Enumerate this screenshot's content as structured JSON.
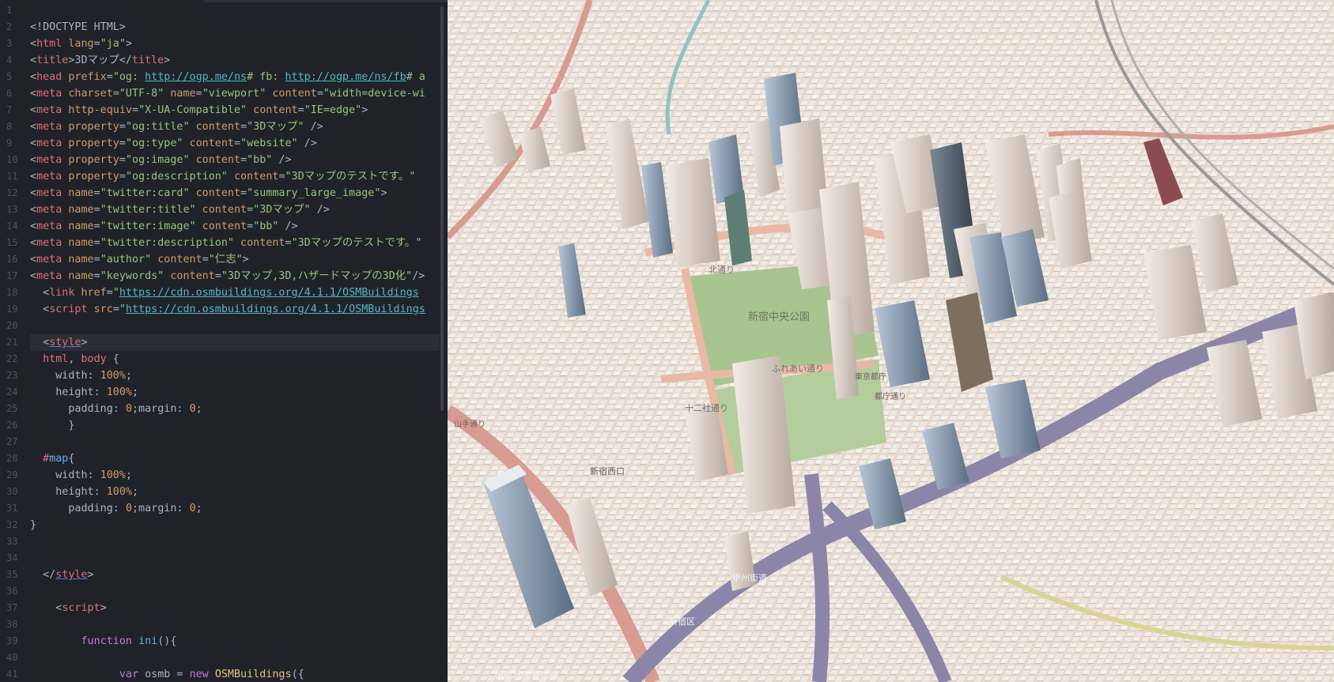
{
  "line_numbers": [
    "1",
    "2",
    "3",
    "4",
    "5",
    "6",
    "7",
    "8",
    "9",
    "10",
    "11",
    "12",
    "13",
    "14",
    "15",
    "16",
    "17",
    "18",
    "19",
    "20",
    "21",
    "22",
    "23",
    "24",
    "25",
    "26",
    "27",
    "28",
    "29",
    "30",
    "31",
    "32",
    "33",
    "34",
    "35",
    "36",
    "37",
    "38",
    "39",
    "40",
    "41"
  ],
  "code": {
    "l2": "<!DOCTYPE HTML>",
    "l3": {
      "o": "<",
      "tag": "html",
      "attr": " lang",
      "eq": "=",
      "val": "\"ja\"",
      "c": ">"
    },
    "l4": {
      "o": "<",
      "tag": "title",
      "mid": ">3Dマップ</",
      "tag2": "title",
      "c": ">"
    },
    "l5": {
      "o": "<",
      "tag": "head",
      "attr": " prefix",
      "eq": "=",
      "q1": "\"og: ",
      "url1": "http://ogp.me/ns",
      "mid": "# fb: ",
      "url2": "http://ogp.me/ns/fb",
      "tail": "# a"
    },
    "l6": {
      "o": "<",
      "tag": "meta",
      "a1": " charset",
      "eq1": "=",
      "v1": "\"UTF-8\"",
      "a2": " name",
      "eq2": "=",
      "v2": "\"viewport\"",
      "a3": " content",
      "eq3": "=",
      "v3": "\"width=device-wi"
    },
    "l7": {
      "o": "<",
      "tag": "meta",
      "a1": " http-equiv",
      "eq1": "=",
      "v1": "\"X-UA-Compatible\"",
      "a2": " content",
      "eq2": "=",
      "v2": "\"IE=edge\"",
      "c": ">"
    },
    "l8": {
      "o": "<",
      "tag": "meta",
      "a1": " property",
      "eq1": "=",
      "v1": "\"og:title\"",
      "a2": " content",
      "eq2": "=",
      "v2": "\"3Dマップ\"",
      "c": " />"
    },
    "l9": {
      "o": "<",
      "tag": "meta",
      "a1": " property",
      "eq1": "=",
      "v1": "\"og:type\"",
      "a2": " content",
      "eq2": "=",
      "v2": "\"website\"",
      "c": " />"
    },
    "l10": {
      "o": "<",
      "tag": "meta",
      "a1": " property",
      "eq1": "=",
      "v1": "\"og:image\"",
      "a2": " content",
      "eq2": "=",
      "v2": "\"bb\"",
      "c": " />"
    },
    "l11": {
      "o": "<",
      "tag": "meta",
      "a1": " property",
      "eq1": "=",
      "v1": "\"og:description\"",
      "a2": " content",
      "eq2": "=",
      "v2": "\"3Dマップのテストです。\""
    },
    "l12": {
      "o": "<",
      "tag": "meta",
      "a1": " name",
      "eq1": "=",
      "v1": "\"twitter:card\"",
      "a2": " content",
      "eq2": "=",
      "v2": "\"summary_large_image\"",
      "c": ">"
    },
    "l13": {
      "o": "<",
      "tag": "meta",
      "a1": " name",
      "eq1": "=",
      "v1": "\"twitter:title\"",
      "a2": " content",
      "eq2": "=",
      "v2": "\"3Dマップ\"",
      "c": " />"
    },
    "l14": {
      "o": "<",
      "tag": "meta",
      "a1": " name",
      "eq1": "=",
      "v1": "\"twitter:image\"",
      "a2": " content",
      "eq2": "=",
      "v2": "\"bb\"",
      "c": " />"
    },
    "l15": {
      "o": "<",
      "tag": "meta",
      "a1": " name",
      "eq1": "=",
      "v1": "\"twitter:description\"",
      "a2": " content",
      "eq2": "=",
      "v2": "\"3Dマップのテストです。\""
    },
    "l16": {
      "o": "<",
      "tag": "meta",
      "a1": " name",
      "eq1": "=",
      "v1": "\"author\"",
      "a2": " content",
      "eq2": "=",
      "v2": "\"仁志\"",
      "c": ">"
    },
    "l17": {
      "o": "<",
      "tag": "meta",
      "a1": " name",
      "eq1": "=",
      "v1": "\"keywords\"",
      "a2": " content",
      "eq2": "=",
      "v2": "\"3Dマップ,3D,ハザードマップの3D化\"",
      "c": "/>"
    },
    "l18": {
      "ind": "  ",
      "o": "<",
      "tag": "link",
      "a1": " href",
      "eq1": "=",
      "q": "\"",
      "url": "https://cdn.osmbuildings.org/4.1.1/OSMBuildings"
    },
    "l19": {
      "ind": "  ",
      "o": "<",
      "tag": "script",
      "a1": " src",
      "eq1": "=",
      "q": "\"",
      "url": "https://cdn.osmbuildings.org/4.1.1/OSMBuildings"
    },
    "l21": {
      "ind": "  ",
      "o": "<",
      "tag": "style",
      "c": ">"
    },
    "l22": {
      "ind": "  ",
      "s1": "html",
      "sep": ", ",
      "s2": "body",
      "rest": " {"
    },
    "l23": {
      "ind": "    ",
      "prop": "width: ",
      "num": "100%",
      "end": ";"
    },
    "l24": {
      "ind": "    ",
      "prop": "height: ",
      "num": "100%",
      "end": ";"
    },
    "l25": {
      "ind": "      ",
      "prop": "padding: ",
      "num": "0",
      "mid": ";margin: ",
      "num2": "0",
      "end": ";"
    },
    "l26": "      }",
    "l28": {
      "ind": "  ",
      "hash": "#",
      "sel": "map",
      "rest": "{"
    },
    "l29": {
      "ind": "    ",
      "prop": "width: ",
      "num": "100%",
      "end": ";"
    },
    "l30": {
      "ind": "    ",
      "prop": "height: ",
      "num": "100%",
      "end": ";"
    },
    "l31": {
      "ind": "      ",
      "prop": "padding: ",
      "num": "0",
      "mid": ";margin: ",
      "num2": "0",
      "end": ";"
    },
    "l32": "}",
    "l35": {
      "ind": "  ",
      "o": "</",
      "tag": "style",
      "c": ">"
    },
    "l37": {
      "ind": "    ",
      "o": "<",
      "tag": "script",
      "c": ">"
    },
    "l39": {
      "ind": "        ",
      "kw": "function",
      "sp": " ",
      "fn": "ini",
      "rest": "(){"
    },
    "l41": {
      "ind": "              ",
      "kw": "var",
      "mid": " osmb = ",
      "kw2": "new",
      "sp": " ",
      "cls": "OSMBuildings",
      "rest": "({"
    }
  },
  "map": {
    "labels": [
      "新宿中央公園",
      "北通り",
      "十二社通り",
      "ふれあい通り",
      "東京都庁",
      "都庁通り",
      "新宿区",
      "甲州街道",
      "国道20号新宿線",
      "山手通り",
      "新宿西口"
    ]
  },
  "colors": {
    "editor_bg": "#1f2329",
    "active_line": "#2a2f37",
    "tag": "#e06c75",
    "string": "#98c379",
    "attribute": "#d19a66",
    "url": "#56b6c2",
    "keyword": "#c678dd",
    "function": "#61afef",
    "class": "#e5c07b",
    "map_ground": "#e6dcd3",
    "park": "#a8c491",
    "road_major": "#8b86a8",
    "road_minor": "#e9b9a6"
  }
}
